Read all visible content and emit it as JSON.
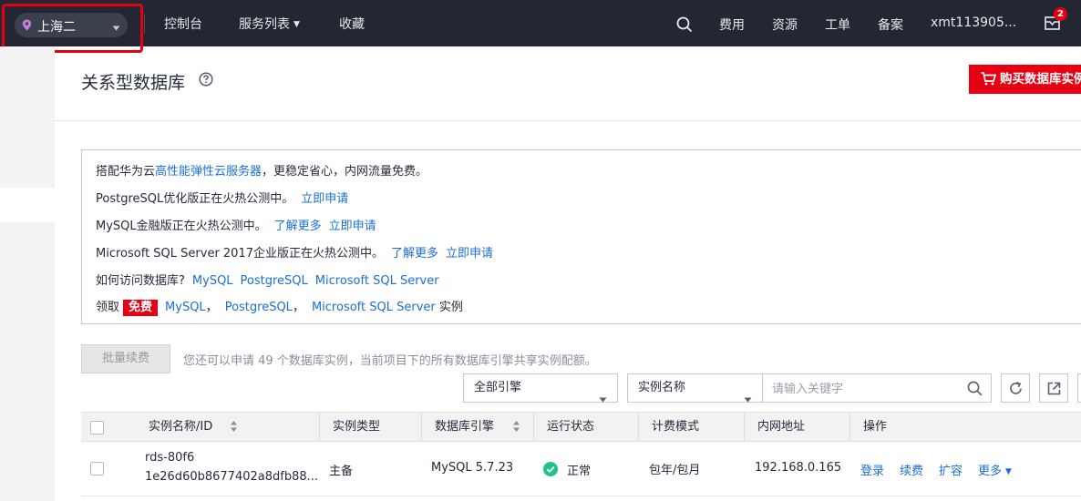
{
  "topbar": {
    "region": "上海二",
    "nav": [
      "控制台",
      "服务列表",
      "收藏"
    ],
    "right_links": [
      "费用",
      "资源",
      "工单",
      "备案"
    ],
    "user": "xmt113905...",
    "mail_badge": "2"
  },
  "header": {
    "title": "关系型数据库",
    "buy_label": "购买数据库实例"
  },
  "notice": {
    "line1": {
      "prefix": "搭配华为云",
      "link": "高性能弹性云服务器",
      "suffix": "，更稳定省心，内网流量免费。"
    },
    "line2": {
      "text": "PostgreSQL优化版正在火热公测中。",
      "link": "立即申请"
    },
    "line3": {
      "text": "MySQL金融版正在火热公测中。",
      "link1": "了解更多",
      "link2": "立即申请"
    },
    "line4": {
      "text": "Microsoft SQL Server 2017企业版正在火热公测中。",
      "link1": "了解更多",
      "link2": "立即申请"
    },
    "line5": {
      "text": "如何访问数据库?",
      "links": [
        "MySQL",
        "PostgreSQL",
        "Microsoft SQL Server"
      ]
    },
    "line6": {
      "prefix": "领取",
      "badge": "免费",
      "link1": "MySQL",
      "sep1": "，",
      "link2": "PostgreSQL",
      "sep2": "，",
      "link3": "Microsoft SQL Server",
      "suffix": " 实例"
    }
  },
  "toolbar": {
    "renew_label": "批量续费",
    "quota_text": "您还可以申请 49 个数据库实例，当前项目下的所有数据库引擎共享实例配额。",
    "engine_select": "全部引擎",
    "field_select": "实例名称",
    "search_placeholder": "请输入关键字"
  },
  "table": {
    "headers": [
      "实例名称/ID",
      "实例类型",
      "数据库引擎",
      "运行状态",
      "计费模式",
      "内网地址",
      "操作"
    ],
    "rows": [
      {
        "name": "rds-80f6",
        "id": "1e26d60b8677402a8dfb88...",
        "type": "主备",
        "engine": "MySQL 5.7.23",
        "status": "正常",
        "billing": "包年/包月",
        "ip": "192.168.0.165",
        "actions": [
          "登录",
          "续费",
          "扩容",
          "更多"
        ]
      }
    ]
  },
  "colors": {
    "topbar_bg": "#232733",
    "accent_red": "#e60012",
    "link_blue": "#1a6fd6",
    "status_green": "#21c286"
  }
}
